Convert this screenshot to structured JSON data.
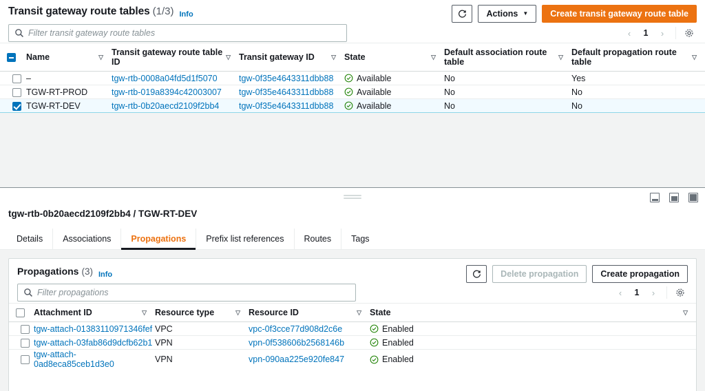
{
  "header": {
    "title": "Transit gateway route tables",
    "count": "(1/3)",
    "info_label": "Info",
    "refresh_icon": "refresh-icon",
    "actions_label": "Actions",
    "create_label": "Create transit gateway route table"
  },
  "filter": {
    "placeholder": "Filter transit gateway route tables",
    "search_icon": "search-icon"
  },
  "pagination": {
    "prev": "‹",
    "page": "1",
    "next": "›",
    "settings_icon": "gear-icon"
  },
  "main_table": {
    "columns": [
      {
        "label": "Name",
        "sortable": true
      },
      {
        "label": "Transit gateway route table ID",
        "sortable": true
      },
      {
        "label": "Transit gateway ID",
        "sortable": true
      },
      {
        "label": "State",
        "sortable": true
      },
      {
        "label": "Default association route table",
        "sortable": true
      },
      {
        "label": "Default propagation route table",
        "sortable": true
      }
    ],
    "rows": [
      {
        "selected": false,
        "name": "–",
        "rtb_id": "tgw-rtb-0008a04fd5d1f5070",
        "tgw_id": "tgw-0f35e4643311dbb88",
        "state": "Available",
        "default_association": "No",
        "default_propagation": "Yes"
      },
      {
        "selected": false,
        "name": "TGW-RT-PROD",
        "rtb_id": "tgw-rtb-019a8394c42003007",
        "tgw_id": "tgw-0f35e4643311dbb88",
        "state": "Available",
        "default_association": "No",
        "default_propagation": "No"
      },
      {
        "selected": true,
        "name": "TGW-RT-DEV",
        "rtb_id": "tgw-rtb-0b20aecd2109f2bb4",
        "tgw_id": "tgw-0f35e4643311dbb88",
        "state": "Available",
        "default_association": "No",
        "default_propagation": "No"
      }
    ]
  },
  "split_panel": {
    "grabber_icon": "resize-handle-icon",
    "layout_buttons": [
      "panel-split-bottom-icon",
      "panel-split-side-icon",
      "panel-maximize-icon"
    ]
  },
  "detail": {
    "title": "tgw-rtb-0b20aecd2109f2bb4 / TGW-RT-DEV",
    "tabs": [
      {
        "label": "Details",
        "active": false
      },
      {
        "label": "Associations",
        "active": false
      },
      {
        "label": "Propagations",
        "active": true
      },
      {
        "label": "Prefix list references",
        "active": false
      },
      {
        "label": "Routes",
        "active": false
      },
      {
        "label": "Tags",
        "active": false
      }
    ]
  },
  "propagations": {
    "title": "Propagations",
    "count": "(3)",
    "info_label": "Info",
    "refresh_icon": "refresh-icon",
    "delete_label": "Delete propagation",
    "create_label": "Create propagation",
    "filter_placeholder": "Filter propagations",
    "pagination": {
      "prev": "‹",
      "page": "1",
      "next": "›",
      "settings_icon": "gear-icon"
    },
    "columns": [
      {
        "label": "Attachment ID",
        "sortable": true
      },
      {
        "label": "Resource type",
        "sortable": true
      },
      {
        "label": "Resource ID",
        "sortable": true
      },
      {
        "label": "State",
        "sortable": true
      }
    ],
    "rows": [
      {
        "attachment_id": "tgw-attach-01383110971346fef",
        "resource_type": "VPC",
        "resource_id": "vpc-0f3cce77d908d2c6e",
        "state": "Enabled"
      },
      {
        "attachment_id": "tgw-attach-03fab86d9dcfb62b1",
        "resource_type": "VPN",
        "resource_id": "vpn-0f538606b2568146b",
        "state": "Enabled"
      },
      {
        "attachment_id": "tgw-attach-0ad8eca85ceb1d3e0",
        "resource_type": "VPN",
        "resource_id": "vpn-090aa225e920fe847",
        "state": "Enabled"
      }
    ]
  },
  "colors": {
    "accent_orange": "#ec7211",
    "link_blue": "#0073bb",
    "status_green": "#1d8102",
    "selected_row_bg": "#f1faff",
    "selected_row_border": "#8ed7e8"
  }
}
